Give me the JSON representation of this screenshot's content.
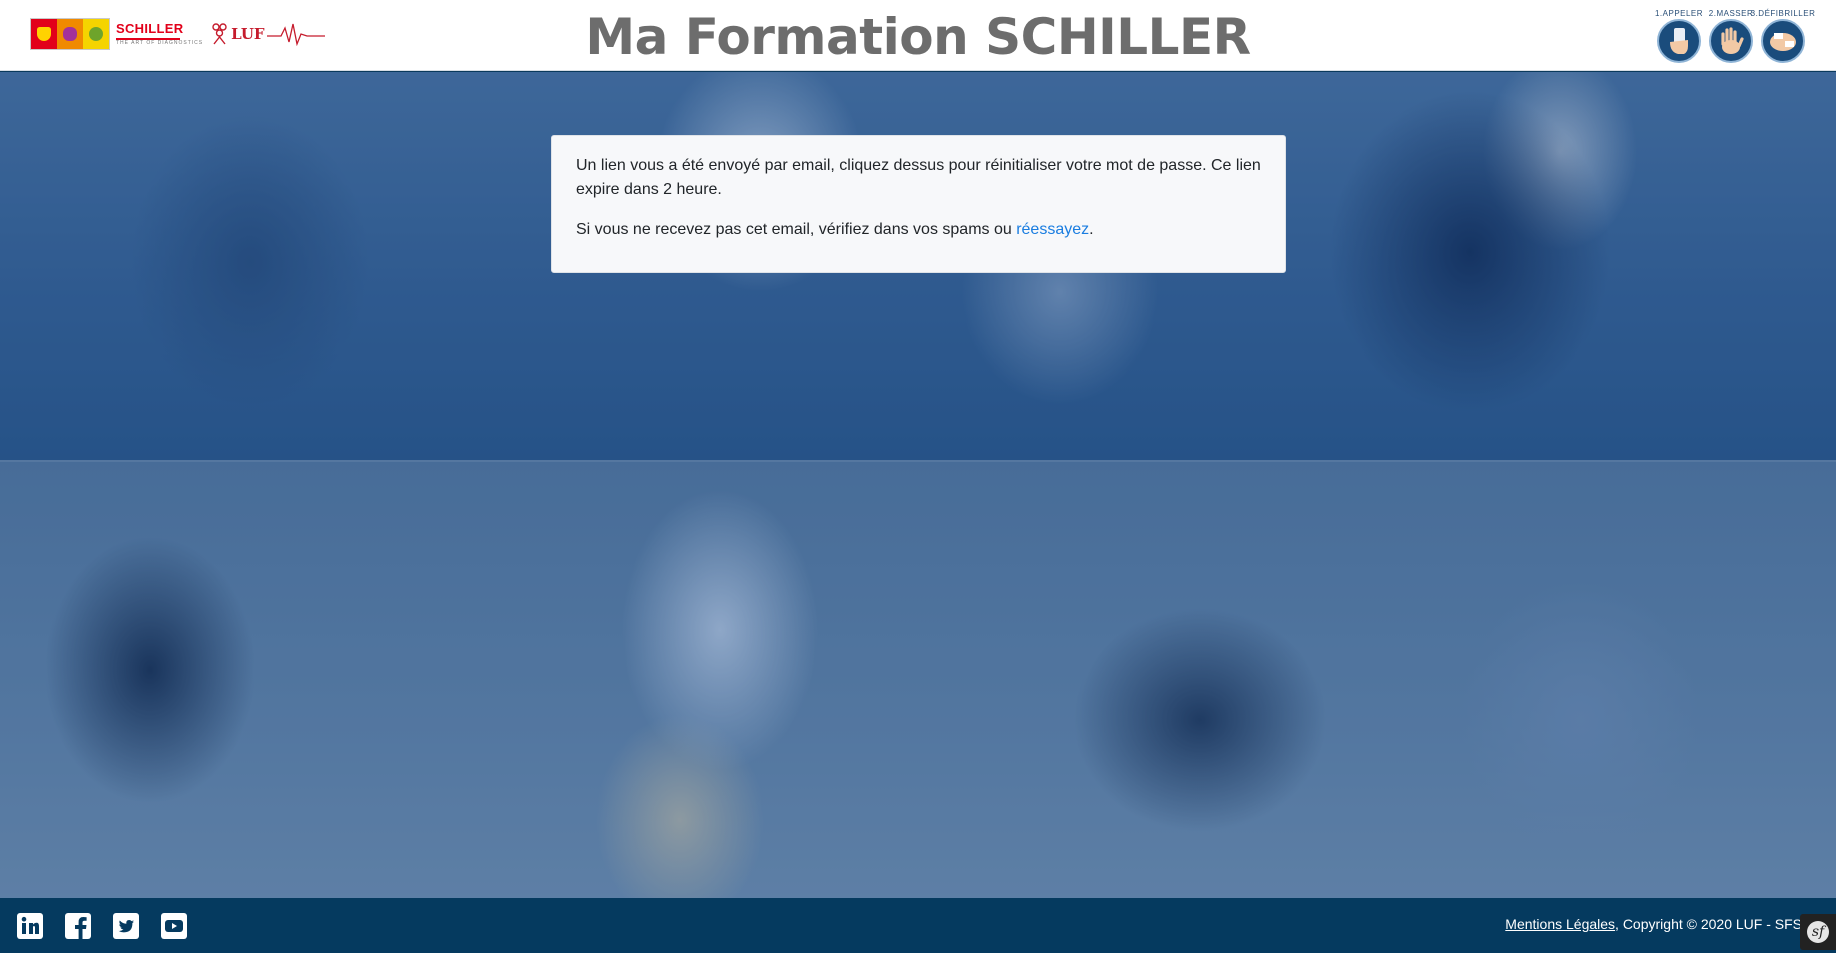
{
  "header": {
    "title": "Ma Formation SCHILLER",
    "brand_left": {
      "schiller_name": "SCHILLER",
      "schiller_sub": "THE ART OF DIAGNOSTICS",
      "luf_name": "LUF"
    },
    "steps": [
      {
        "label": "1.APPELER",
        "icon": "phone-hand-icon"
      },
      {
        "label": "2.MASSER",
        "icon": "hand-icon"
      },
      {
        "label": "3.DÉFIBRILLER",
        "icon": "defibrillator-icon"
      }
    ]
  },
  "message": {
    "line1": "Un lien vous a été envoyé par email, cliquez dessus pour réinitialiser votre mot de passe. Ce lien expire dans 2 heure.",
    "line2_prefix": "Si vous ne recevez pas cet email, vérifiez dans vos spams ou ",
    "retry_link": "réessayez",
    "line2_suffix": "."
  },
  "footer": {
    "social": [
      "linkedin-icon",
      "facebook-icon",
      "twitter-icon",
      "youtube-icon"
    ],
    "legal_link": "Mentions Légales",
    "copyright": ", Copyright © 2020 LUF - SFS",
    "debug_badge": "sf"
  },
  "colors": {
    "header_bg": "#ffffff",
    "title": "#6d6d6d",
    "footer_bg": "#053a5f",
    "link": "#1a7de0",
    "brand_red": "#e2001a"
  }
}
